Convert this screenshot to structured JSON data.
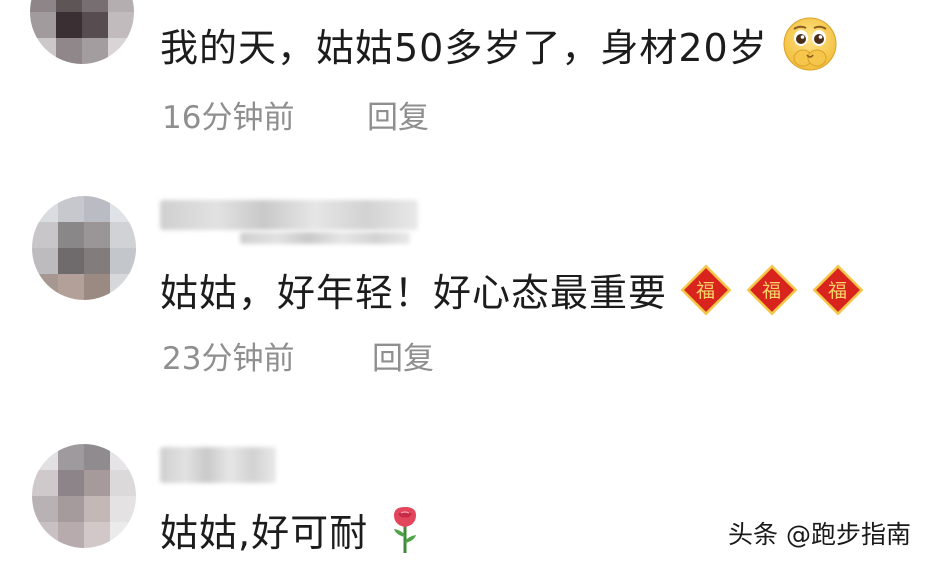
{
  "comments": [
    {
      "text": "我的天，姑姑50多岁了，身材20岁",
      "emoji": "pleading-face-icon",
      "time": "16分钟前",
      "reply_label": "回复"
    },
    {
      "text": "姑姑，好年轻！好心态最重要",
      "emoji": "fu-blessing-icon",
      "emoji_char": "福",
      "emoji_count": 3,
      "time": "23分钟前",
      "reply_label": "回复"
    },
    {
      "text": "姑姑,好可耐",
      "emoji": "rose-icon"
    }
  ],
  "watermark": "头条 @跑步指南",
  "colors": {
    "text": "#1c1c1c",
    "meta": "#8f8f8f",
    "fu_red": "#d8241c",
    "fu_gold": "#f4c64a"
  }
}
